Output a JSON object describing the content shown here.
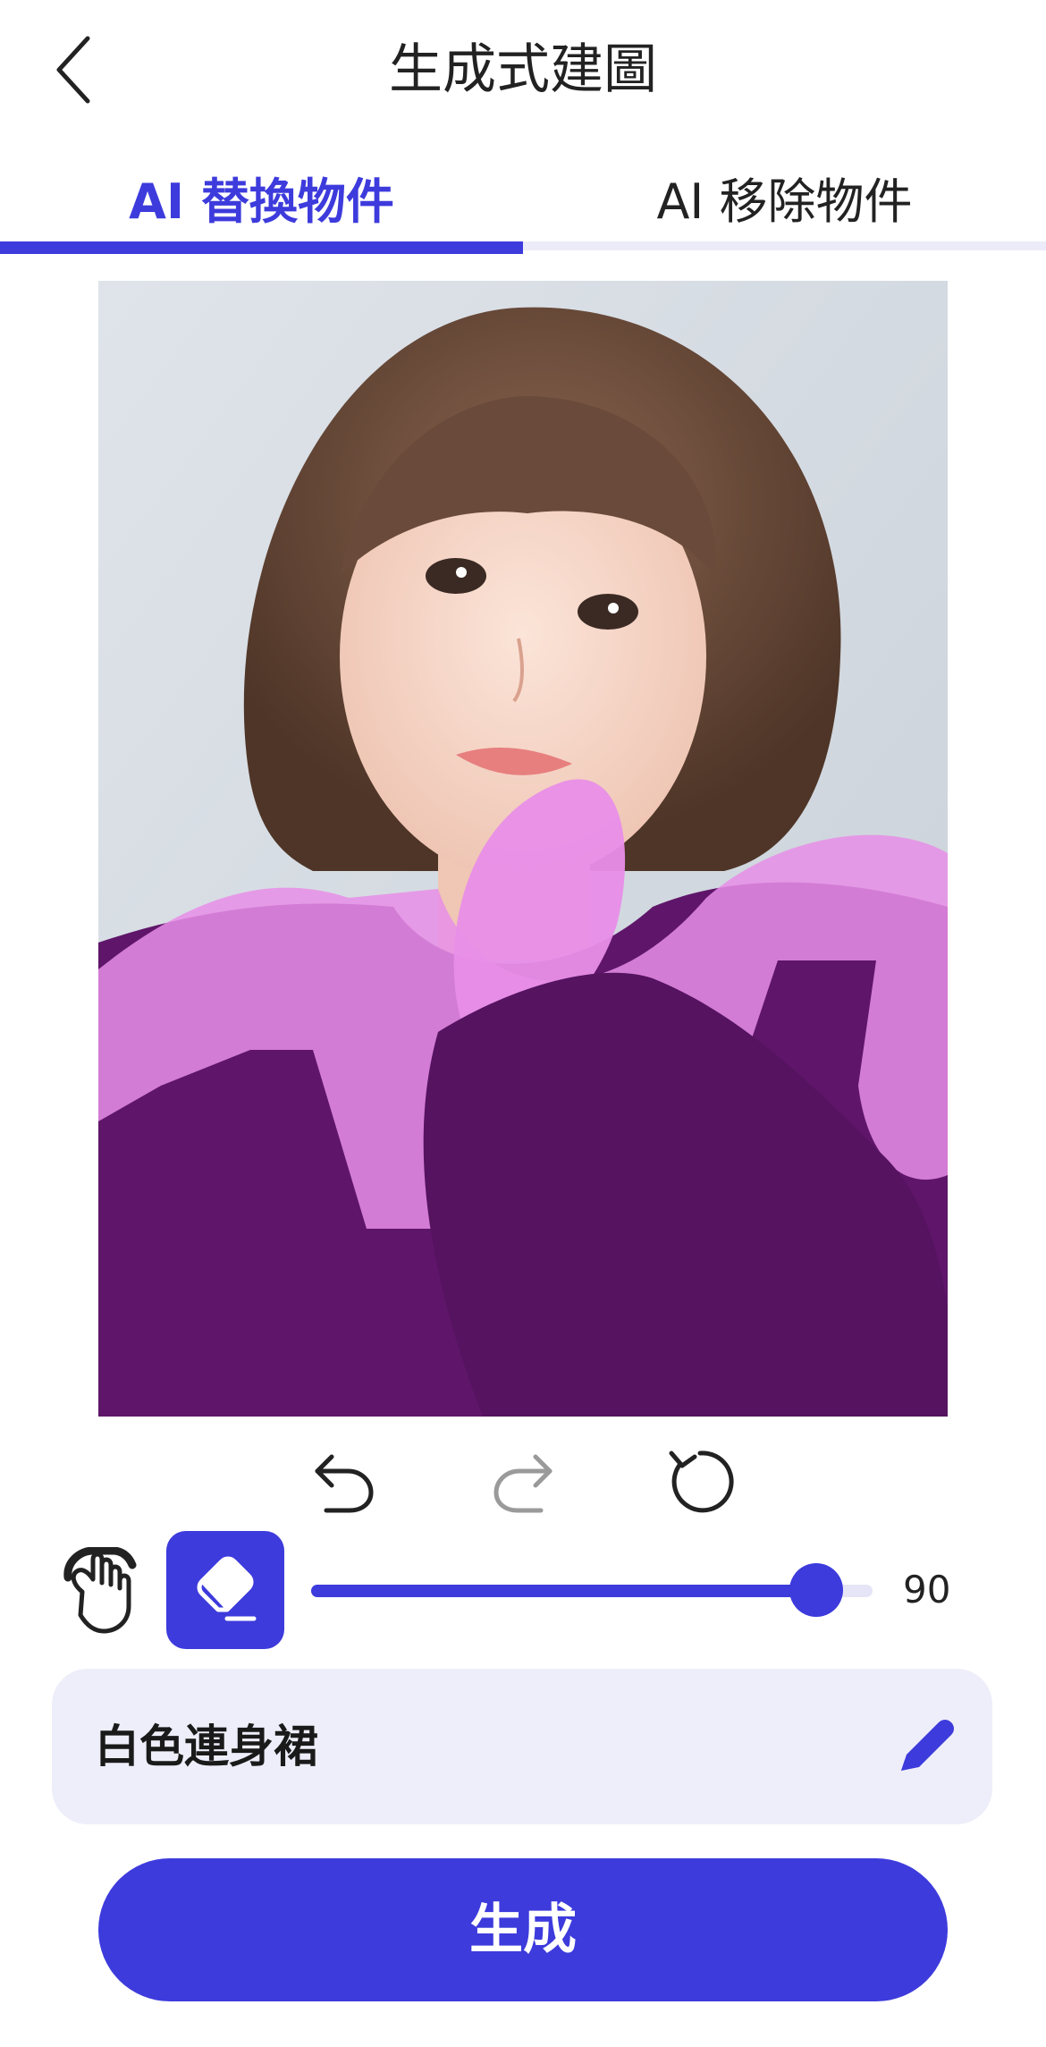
{
  "header": {
    "title": "生成式建圖",
    "back_icon": "chevron-left-icon"
  },
  "tabs": [
    {
      "label": "AI 替換物件",
      "active": true
    },
    {
      "label": "AI 移除物件",
      "active": false
    }
  ],
  "colors": {
    "accent": "#3d3bdc",
    "mask": "#e88ee8",
    "panel": "#eeeefa"
  },
  "toolbar": {
    "icons": [
      "undo-icon",
      "redo-icon",
      "reset-icon"
    ]
  },
  "brush": {
    "size_label": "90",
    "level_percent": 90,
    "tools": [
      "hand-icon",
      "eraser-icon"
    ]
  },
  "prompt": {
    "text": "白色連身裙",
    "icon": "pen-icon"
  },
  "generate": {
    "label": "生成"
  }
}
